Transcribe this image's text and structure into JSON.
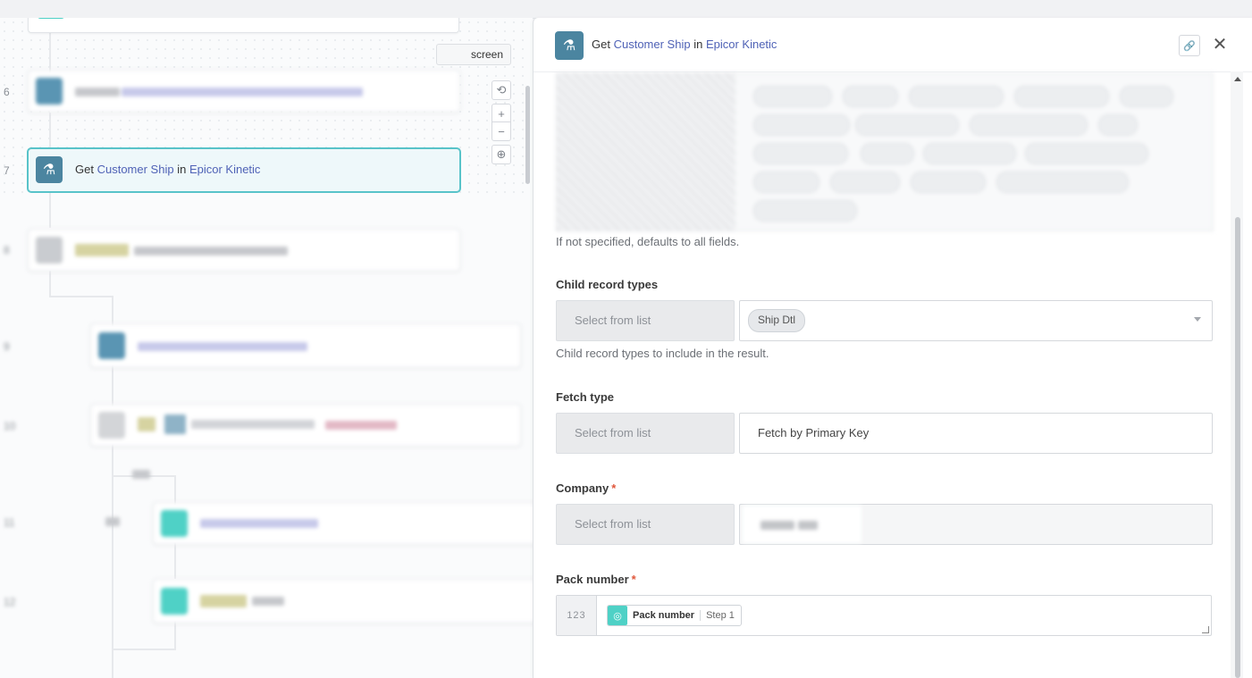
{
  "canvas": {
    "fullscreen_label": "screen",
    "steps": [
      {
        "num": "6"
      },
      {
        "num": "7"
      },
      {
        "num": "8"
      },
      {
        "num": "9"
      },
      {
        "num": "10"
      },
      {
        "num": "11"
      },
      {
        "num": "12"
      }
    ],
    "active_step": {
      "prefix": "Get",
      "object": "Customer Ship",
      "in": "in",
      "app": "Epicor Kinetic"
    },
    "zoom": {
      "reset": "⟲",
      "in": "+",
      "out": "−",
      "fit": "⊕"
    }
  },
  "panel": {
    "header": {
      "prefix": "Get",
      "object": "Customer Ship",
      "in": "in",
      "app": "Epicor Kinetic",
      "link_icon": "link-icon",
      "close_icon": "close-icon"
    },
    "fields_hint": "If not specified, defaults to all fields.",
    "child_record_types": {
      "label": "Child record types",
      "toggle": "Select from list",
      "value": "Ship Dtl",
      "hint": "Child record types to include in the result."
    },
    "fetch_type": {
      "label": "Fetch type",
      "toggle": "Select from list",
      "value": "Fetch by Primary Key"
    },
    "company": {
      "label": "Company",
      "required": "*",
      "toggle": "Select from list"
    },
    "pack_number": {
      "label": "Pack number",
      "required": "*",
      "prefix": "123",
      "pill_name": "Pack number",
      "pill_step": "Step 1"
    }
  },
  "colors": {
    "accent": "#58c3c9",
    "icon_bg": "#4b85a0",
    "link": "#4f62b6",
    "required": "#e0573b"
  }
}
